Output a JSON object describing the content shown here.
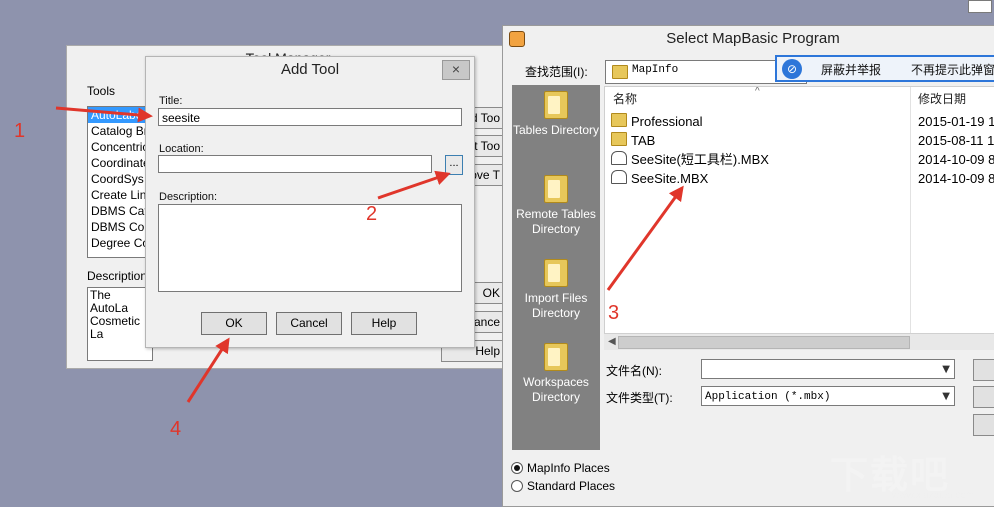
{
  "tool_manager": {
    "title": "Tool Manager",
    "tools_label": "Tools",
    "tools": [
      "AutoLabeler",
      "Catalog Bro",
      "Concentric",
      "Coordinate",
      "CoordSys B",
      "Create Line",
      "DBMS Cata",
      "DBMS Cou",
      "Degree Co"
    ],
    "description_label": "Description:",
    "description_text": "The AutoLa Cosmetic La",
    "buttons": [
      "d Too",
      "lit Too",
      "nove T",
      "OK",
      "Cance",
      "Help"
    ]
  },
  "add_tool": {
    "title": "Add Tool",
    "close": "×",
    "title_label": "Title:",
    "title_value": "seesite",
    "location_label": "Location:",
    "location_value": "",
    "browse_label": "...",
    "description_label": "Description:",
    "ok": "OK",
    "cancel": "Cancel",
    "help": "Help"
  },
  "mapbasic_dialog": {
    "title": "Select MapBasic Program",
    "look_in_label": "查找范围(I):",
    "look_in_value": "MapInfo",
    "places": [
      {
        "label": "Tables Directory"
      },
      {
        "label": "Remote Tables Directory"
      },
      {
        "label": "Import Files Directory"
      },
      {
        "label": "Workspaces Directory"
      }
    ],
    "columns": {
      "name": "名称",
      "modified": "修改日期"
    },
    "files": [
      {
        "name": "Professional",
        "date": "2015-01-19 1",
        "type": "folder"
      },
      {
        "name": "TAB",
        "date": "2015-08-11 1",
        "type": "folder"
      },
      {
        "name": "SeeSite(短工具栏).MBX",
        "date": "2014-10-09 8",
        "type": "mbx"
      },
      {
        "name": "SeeSite.MBX",
        "date": "2014-10-09 8",
        "type": "mbx"
      }
    ],
    "filename_label": "文件名(N):",
    "filename_value": "",
    "filetype_label": "文件类型(T):",
    "filetype_value": "Application (*.mbx)",
    "radio_mapinfo": "MapInfo Places",
    "radio_standard": "Standard Places"
  },
  "notification": {
    "block_report": "屏蔽并举报",
    "never_show": "不再提示此弹窗"
  },
  "annotations": [
    "1",
    "2",
    "3",
    "4"
  ],
  "watermark": "下载吧",
  "watermark_url": "www.xiazaiba.com",
  "colors": {
    "annotation": "#e0362b",
    "desktop": "#8e93ad",
    "accent": "#2d76d9"
  }
}
